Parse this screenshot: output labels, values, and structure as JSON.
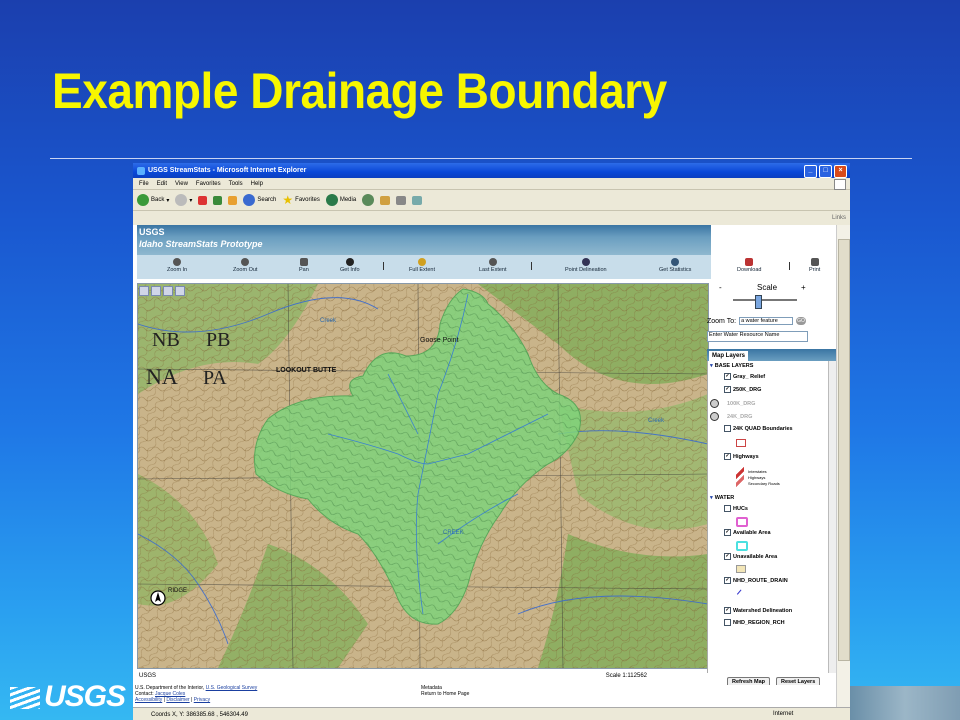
{
  "slide": {
    "title": "Example Drainage Boundary",
    "footer_logo": "USGS",
    "title_color": "#f7f600"
  },
  "browser": {
    "window_title": "USGS StreamStats - Microsoft Internet Explorer",
    "menu": [
      "File",
      "Edit",
      "View",
      "Favorites",
      "Tools",
      "Help"
    ],
    "toolbar": {
      "back": "Back",
      "search": "Search",
      "favorites": "Favorites",
      "media": "Media"
    },
    "links_label": "Links",
    "status_coords": "Coords X, Y: 386385.68 , 546304.49",
    "status_zone": "Internet"
  },
  "app": {
    "logo": "USGS",
    "title": "Idaho StreamStats Prototype",
    "tools": [
      "Zoom In",
      "Zoom Out",
      "Pan",
      "Get Info",
      "Full Extent",
      "Last Extent",
      "Point Delineation",
      "Get Statistics"
    ],
    "right_tools": [
      "Download",
      "Print"
    ],
    "scale_label": "Scale",
    "scale_minus": "-",
    "scale_plus": "+",
    "zoom_to_label": "Zoom To:",
    "zoom_to_select": "a water feature",
    "go_label": "GO",
    "water_resource_placeholder": "Enter Water Resource Name",
    "map_layers_tab": "Map Layers",
    "map_footer_left": "USGS",
    "map_footer_scale": "Scale 1:112562",
    "layers": {
      "base_header": "BASE LAYERS",
      "gray_relief": "Gray_ Relief",
      "drg_250k": "250K_DRG",
      "drg_100k": "100K_DRG",
      "drg_24k": "24K_DRG",
      "quad_24k": "24K QUAD Boundaries",
      "highways": "Highways",
      "legend_interstates": "Interstates",
      "legend_highways": "Highways",
      "legend_secondary": "Secondary Roads",
      "water_header": "WATER",
      "hucs": "HUCs",
      "available": "Available Area",
      "unavailable": "Unavailable Area",
      "nhd_route": "NHD_ROUTE_DRAIN",
      "watershed": "Watershed Delineation",
      "nhd_region": "NHD_REGION_RCH"
    },
    "refresh_label": "Refresh Map",
    "reset_label": "Reset Layers",
    "footer": {
      "dept": "U.S. Department of the Interior,",
      "gs_link": "U.S. Geological Survey",
      "contact": "Contact:",
      "contact_link": "Jacque Coles",
      "accessibility": "Accessibility",
      "disclaimer": "Disclaimer",
      "privacy": "Privacy",
      "metadata": "Metadata",
      "home": "Return to Home Page"
    },
    "map_labels": [
      "Goose Point",
      "LOOKOUT BUTTE",
      "NA",
      "PA",
      "RIDGE",
      "INDIAN",
      "Creek",
      "CREEK",
      "MOUNTAIN",
      "Creek"
    ],
    "colors": {
      "basin_fill": "#7fd27a",
      "topo_base": "#c9b48a",
      "forest": "#8fae62",
      "header_blue": "#3a75a3"
    }
  }
}
